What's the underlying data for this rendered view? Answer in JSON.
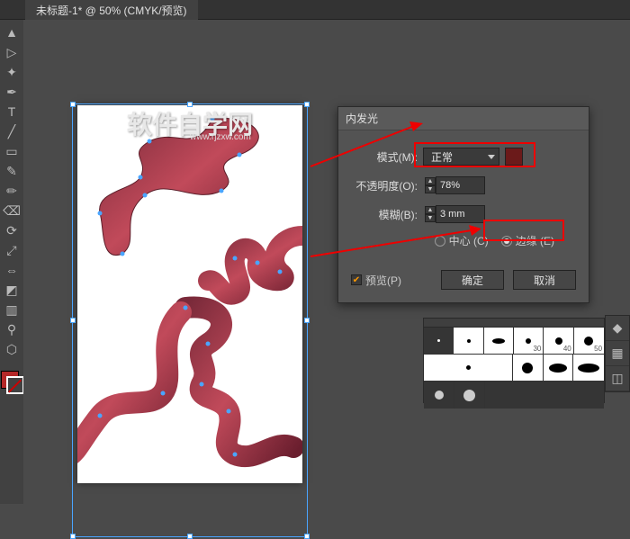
{
  "tab": {
    "title": "未标题-1* @ 50% (CMYK/预览)"
  },
  "watermark": {
    "title": "软件自学网",
    "url": "www.rjzxw.com"
  },
  "dialog": {
    "title": "内发光",
    "mode_label": "模式(M):",
    "mode_value": "正常",
    "opacity_label": "不透明度(O):",
    "opacity_value": "78%",
    "blur_label": "模糊(B):",
    "blur_value": "3 mm",
    "center_label": "中心 (C)",
    "edge_label": "边缘 (E)",
    "preview_label": "预览(P)",
    "ok": "确定",
    "cancel": "取消",
    "glow_color": "#6b1a1a"
  },
  "brushes": {
    "sizes": [
      "30",
      "40",
      "50"
    ]
  }
}
